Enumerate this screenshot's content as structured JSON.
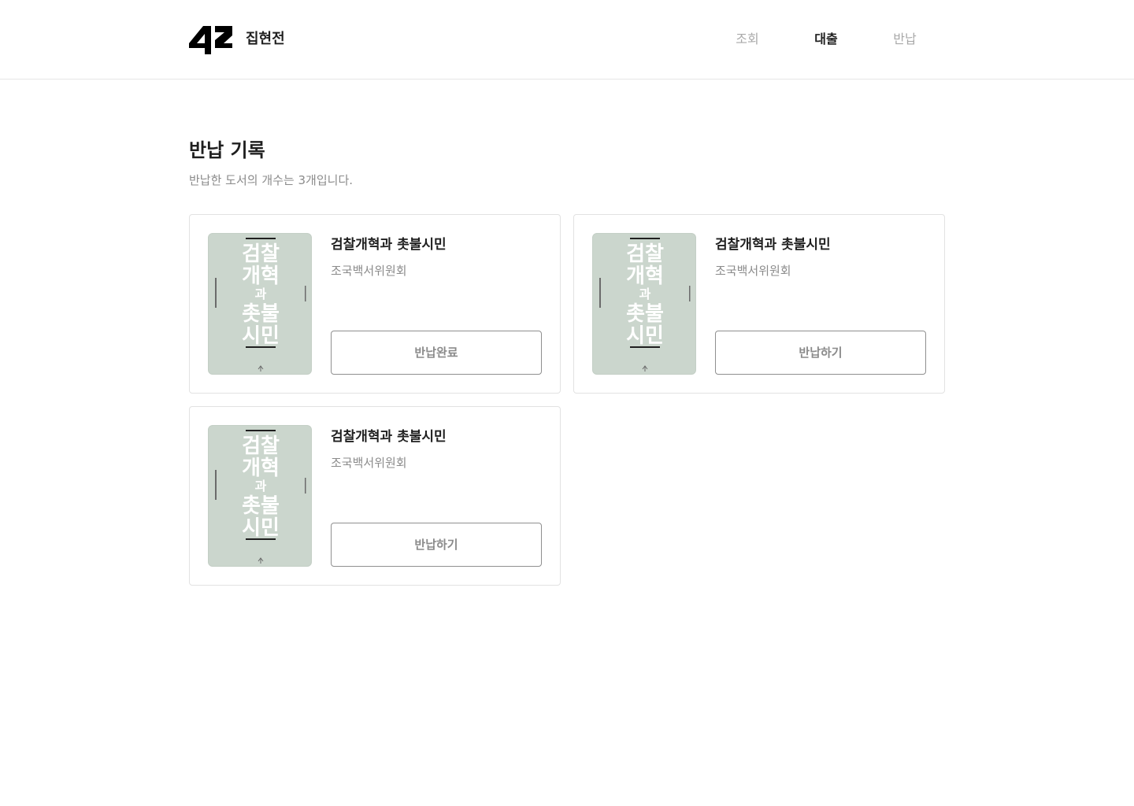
{
  "header": {
    "brand": "집현전",
    "nav": [
      {
        "label": "조회",
        "active": false
      },
      {
        "label": "대출",
        "active": true
      },
      {
        "label": "반납",
        "active": false
      }
    ]
  },
  "main": {
    "title": "반납 기록",
    "subtitle": "반납한 도서의 개수는 3개입니다."
  },
  "books": [
    {
      "title": "검찰개혁과 촛불시민",
      "author": "조국백서위원회",
      "button_label": "반납완료",
      "cover_text": [
        "검찰",
        "개혁",
        "과",
        "촛불",
        "시민"
      ]
    },
    {
      "title": "검찰개혁과 촛불시민",
      "author": "조국백서위원회",
      "button_label": "반납하기",
      "cover_text": [
        "검찰",
        "개혁",
        "과",
        "촛불",
        "시민"
      ]
    },
    {
      "title": "검찰개혁과 촛불시민",
      "author": "조국백서위원회",
      "button_label": "반납하기",
      "cover_text": [
        "검찰",
        "개혁",
        "과",
        "촛불",
        "시민"
      ]
    }
  ],
  "colors": {
    "cover_bg": "#cbd6cd",
    "muted_text": "#8b8b8b",
    "primary_text": "#1f1f1f"
  }
}
